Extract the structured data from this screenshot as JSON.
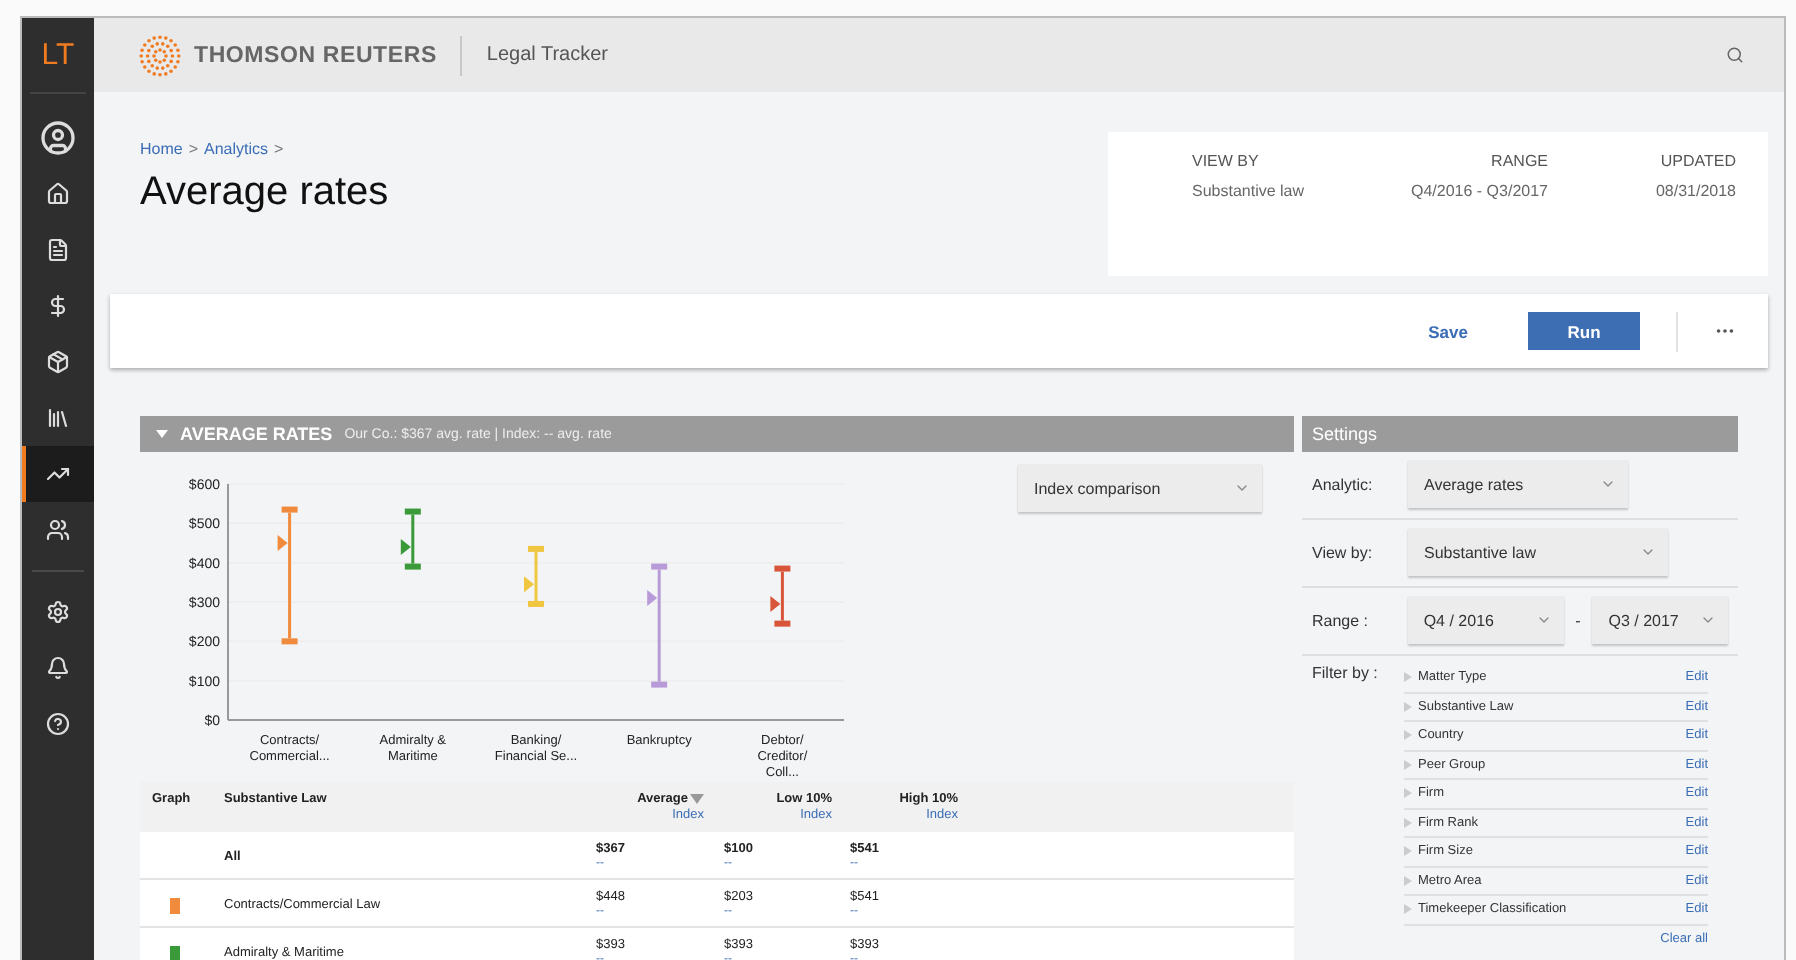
{
  "app": {
    "logo": "LT"
  },
  "sidebar": {
    "items": [
      {
        "selected": false
      },
      {
        "selected": false
      },
      {
        "selected": false
      },
      {
        "selected": false
      },
      {
        "selected": false
      },
      {
        "selected": false
      },
      {
        "selected": true
      },
      {
        "selected": false
      },
      {
        "selected": false
      },
      {
        "selected": false
      },
      {
        "selected": false
      }
    ]
  },
  "header": {
    "brand": "THOMSON REUTERS",
    "product": "Legal Tracker"
  },
  "breadcrumb": {
    "items": [
      "Home",
      "Analytics"
    ],
    "separator": ">"
  },
  "page_title": "Average rates",
  "summary": [
    {
      "label": "VIEW BY",
      "value": "Substantive law"
    },
    {
      "label": "RANGE",
      "value": "Q4/2016 - Q3/2017"
    },
    {
      "label": "UPDATED",
      "value": "08/31/2018"
    }
  ],
  "actions": {
    "save": "Save",
    "run": "Run"
  },
  "report": {
    "title": "AVERAGE RATES",
    "subtitle": "Our Co.: $367 avg. rate | Index: -- avg. rate",
    "expanded": true,
    "comparison_select": "Index comparison",
    "chart_data": {
      "type": "scatter",
      "categories": [
        [
          "Contracts/",
          "Commercial..."
        ],
        [
          "Admiralty &",
          "Maritime"
        ],
        [
          "Banking/",
          "Financial Se..."
        ],
        [
          "Bankruptcy"
        ],
        [
          "Debtor/",
          "Creditor/",
          "Coll..."
        ]
      ],
      "grid": true,
      "series": [
        {
          "colors": [
            "#f08a3c",
            "#3a9a3a",
            "#f0c640",
            "#b99ad8",
            "#d9553a"
          ],
          "values": [
            535,
            530,
            435,
            390,
            385
          ]
        },
        {
          "colors": [
            "#f08a3c",
            "#3a9a3a",
            "#f0c640",
            "#b99ad8",
            "#d9553a"
          ],
          "values": [
            450,
            440,
            345,
            310,
            295
          ]
        },
        {
          "colors": [
            "#f08a3c",
            "#3a9a3a",
            "#f0c640",
            "#b99ad8",
            "#d9553a"
          ],
          "values": [
            200,
            390,
            295,
            90,
            245
          ]
        }
      ],
      "ylim": [
        0,
        600
      ],
      "yticks": [
        {
          "value": 0,
          "label": "$0"
        },
        {
          "value": 100,
          "label": "$100"
        },
        {
          "value": 200,
          "label": "$200"
        },
        {
          "value": 300,
          "label": "$300"
        },
        {
          "value": 400,
          "label": "$400"
        },
        {
          "value": 500,
          "label": "$500"
        },
        {
          "value": 600,
          "label": "$600"
        }
      ]
    },
    "table": {
      "columns": [
        {
          "label": "Graph"
        },
        {
          "label": "Substantive Law"
        },
        {
          "label": "Average",
          "sub": "Index",
          "sorted": true
        },
        {
          "label": "Low 10%",
          "sub": "Index",
          "sorted": false
        },
        {
          "label": "High 10%",
          "sub": "Index",
          "sorted": false
        }
      ],
      "rows": [
        {
          "kind": "total",
          "name": "All",
          "values": [
            {
              "amount": "$367",
              "index": "--"
            },
            {
              "amount": "$100",
              "index": "--"
            },
            {
              "amount": "$541",
              "index": "--"
            }
          ]
        },
        {
          "kind": "item",
          "color": "#f08a3c",
          "name": "Contracts/Commercial Law",
          "values": [
            {
              "amount": "$448",
              "index": "--"
            },
            {
              "amount": "$203",
              "index": "--"
            },
            {
              "amount": "$541",
              "index": "--"
            }
          ]
        },
        {
          "kind": "item",
          "color": "#3a9a3a",
          "name": "Admiralty & Maritime",
          "values": [
            {
              "amount": "$393",
              "index": "--"
            },
            {
              "amount": "$393",
              "index": "--"
            },
            {
              "amount": "$393",
              "index": "--"
            }
          ]
        }
      ]
    }
  },
  "settings": {
    "title": "Settings",
    "analytic": {
      "label": "Analytic:",
      "value": "Average rates"
    },
    "view_by": {
      "label": "View by:",
      "value": "Substantive law"
    },
    "range": {
      "label": "Range :",
      "from": "Q4 / 2016",
      "separator": "-",
      "to": "Q3 / 2017"
    },
    "filter": {
      "label": "Filter by :",
      "items": [
        {
          "name": "Matter Type",
          "action": "Edit"
        },
        {
          "name": "Substantive Law",
          "action": "Edit"
        },
        {
          "name": "Country",
          "action": "Edit"
        },
        {
          "name": "Peer Group",
          "action": "Edit"
        },
        {
          "name": "Firm",
          "action": "Edit"
        },
        {
          "name": "Firm Rank",
          "action": "Edit"
        },
        {
          "name": "Firm Size",
          "action": "Edit"
        },
        {
          "name": "Metro Area",
          "action": "Edit"
        },
        {
          "name": "Timekeeper Classification",
          "action": "Edit"
        }
      ],
      "clear": "Clear all"
    }
  }
}
